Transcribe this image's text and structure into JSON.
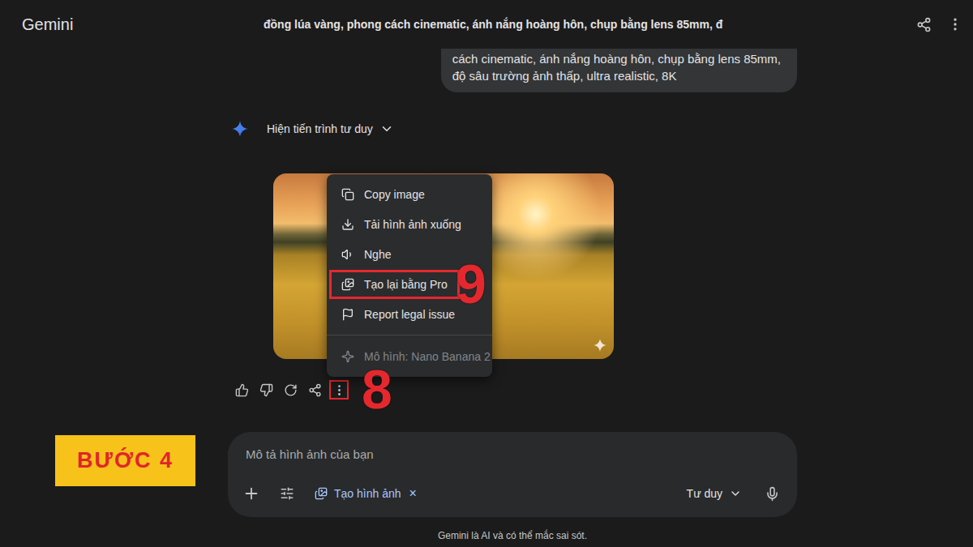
{
  "app": {
    "name": "Gemini"
  },
  "header": {
    "title": "đồng lúa vàng, phong cách cinematic, ánh nắng hoàng hôn, chụp bằng lens 85mm, đ"
  },
  "user_message": {
    "lines": [
      "cách cinematic, ánh nắng hoàng hôn, chụp bằng lens 85mm,",
      "độ sâu trường ảnh thấp, ultra realistic, 8K"
    ]
  },
  "thinking": {
    "label": "Hiện tiến trình tư duy",
    "expanded": false
  },
  "image_menu": {
    "items": [
      {
        "label": "Copy image",
        "kind": "copy",
        "disabled": false,
        "highlighted": false
      },
      {
        "label": "Tải hình ảnh xuống",
        "kind": "download",
        "disabled": false,
        "highlighted": false
      },
      {
        "label": "Nghe",
        "kind": "listen",
        "disabled": false,
        "highlighted": false
      },
      {
        "label": "Tạo lại bằng Pro",
        "kind": "redo-pro",
        "disabled": false,
        "highlighted": true
      },
      {
        "label": "Report legal issue",
        "kind": "report",
        "disabled": false,
        "highlighted": false
      },
      {
        "label": "Mô hình: Nano Banana 2",
        "kind": "model",
        "disabled": true,
        "highlighted": false
      }
    ]
  },
  "actions": [
    {
      "kind": "like",
      "highlighted": false
    },
    {
      "kind": "dislike",
      "highlighted": false
    },
    {
      "kind": "regenerate",
      "highlighted": false
    },
    {
      "kind": "share",
      "highlighted": false
    },
    {
      "kind": "more",
      "highlighted": true
    }
  ],
  "annotations": {
    "menu_marker": "9",
    "actions_marker": "8",
    "step": "BƯỚC 4"
  },
  "composer": {
    "placeholder": "Mô tả hình ảnh của bạn",
    "tool_chip": {
      "label": "Tạo hình ảnh",
      "remove": "×"
    },
    "mode": {
      "label": "Tư duy"
    }
  },
  "footer": {
    "disclaimer": "Gemini là AI và có thể mắc sai sót."
  }
}
